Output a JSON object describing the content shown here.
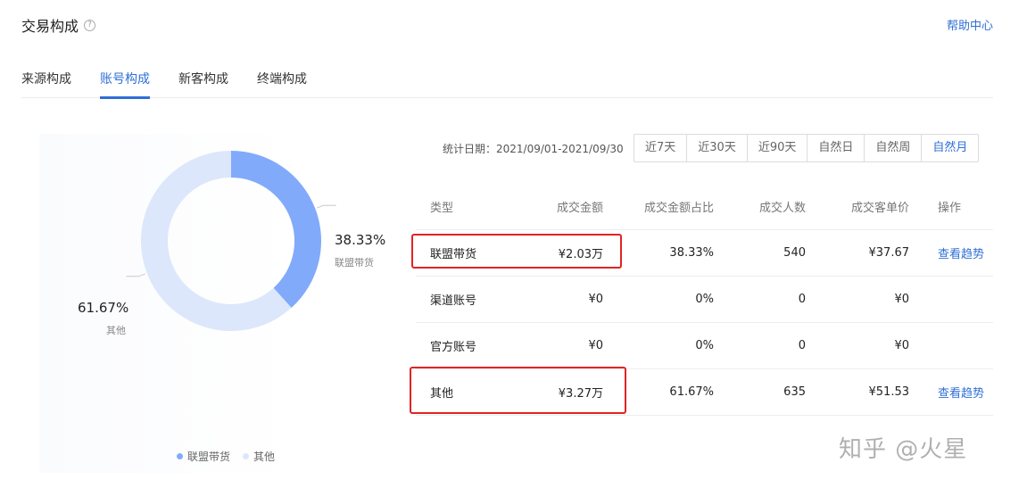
{
  "header": {
    "title": "交易构成",
    "help_icon_glyph": "?",
    "help_link": "帮助中心"
  },
  "tabs": [
    {
      "label": "来源构成",
      "active": false
    },
    {
      "label": "账号构成",
      "active": true
    },
    {
      "label": "新客构成",
      "active": false
    },
    {
      "label": "终端构成",
      "active": false
    }
  ],
  "filters": {
    "date_label": "统计日期：2021/09/01-2021/09/30",
    "ranges": [
      {
        "label": "近7天",
        "active": false
      },
      {
        "label": "近30天",
        "active": false
      },
      {
        "label": "近90天",
        "active": false
      },
      {
        "label": "自然日",
        "active": false
      },
      {
        "label": "自然周",
        "active": false
      },
      {
        "label": "自然月",
        "active": true
      }
    ]
  },
  "chart_data": {
    "type": "pie",
    "donut": true,
    "labels": [
      "联盟带货",
      "其他"
    ],
    "values": [
      38.33,
      61.67
    ],
    "value_labels": [
      "38.33%",
      "61.67%"
    ],
    "colors": [
      "#82aafb",
      "#dde7fb"
    ],
    "legend": [
      {
        "label": "联盟带货",
        "color": "#82aafb"
      },
      {
        "label": "其他",
        "color": "#dde7fb"
      }
    ],
    "legend_position": "bottom"
  },
  "table": {
    "columns": [
      "类型",
      "成交金额",
      "成交金额占比",
      "成交人数",
      "成交客单价",
      "操作"
    ],
    "rows": [
      {
        "type": "联盟带货",
        "amount": "¥2.03万",
        "ratio": "38.33%",
        "people": "540",
        "price": "¥37.67",
        "op": "查看趋势"
      },
      {
        "type": "渠道账号",
        "amount": "¥0",
        "ratio": "0%",
        "people": "0",
        "price": "¥0",
        "op": ""
      },
      {
        "type": "官方账号",
        "amount": "¥0",
        "ratio": "0%",
        "people": "0",
        "price": "¥0",
        "op": ""
      },
      {
        "type": "其他",
        "amount": "¥3.27万",
        "ratio": "61.67%",
        "people": "635",
        "price": "¥51.53",
        "op": "查看趋势"
      }
    ]
  },
  "colors": {
    "accent": "#2f6fd6",
    "highlight": "#e02424"
  },
  "watermark": "知乎 @火星"
}
